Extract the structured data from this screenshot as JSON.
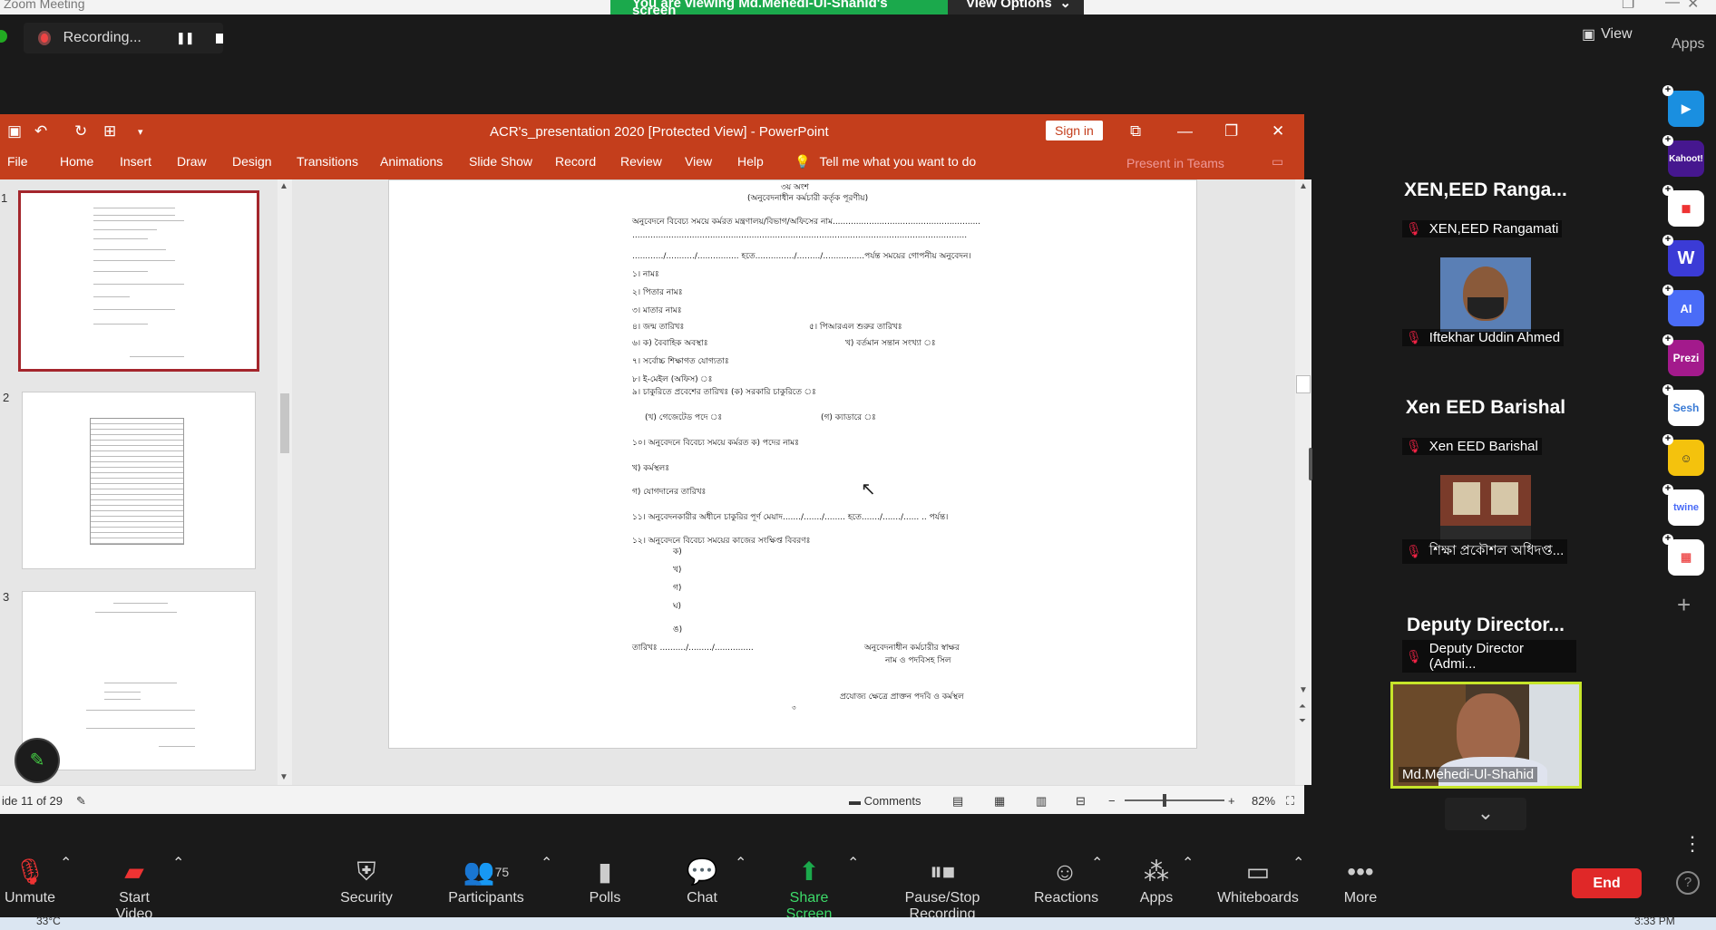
{
  "zoom": {
    "window_title": "Zoom Meeting",
    "banner_text": "You are viewing Md.Mehedi-Ul-Shahid's screen",
    "view_options_label": "View Options",
    "recording_label": "Recording...",
    "view_label": "View",
    "apps_label": "Apps"
  },
  "powerpoint": {
    "title": "ACR's_presentation 2020 [Protected View]  -  PowerPoint",
    "sign_in": "Sign in",
    "tabs": [
      "File",
      "Home",
      "Insert",
      "Draw",
      "Design",
      "Transitions",
      "Animations",
      "Slide Show",
      "Record",
      "Review",
      "View",
      "Help"
    ],
    "tell_me": "Tell me what you want to do",
    "present_in_teams": "Present in Teams",
    "thumb_numbers": [
      "1",
      "2",
      "3"
    ],
    "status": {
      "slide_count": "ide 11 of 29",
      "comments": "Comments",
      "zoom": "82%"
    },
    "slide_text": [
      "৩য় অংশ",
      "(অনুবেদনাধীন কর্মচারী কর্তৃক পূরণীয়)",
      "অনুবেদনে বিবেচ্য সময়ে কর্মরত মন্ত্রণালয়/বিভাগ/অফিসের নাম.........................................................",
      ".................................................................................................................................",
      "............/.........../................ হতে.............../........./................পর্যন্ত সময়ের গোপনীয় অনুবেদন।",
      "১। নামঃ",
      "২। পিতার নামঃ",
      "৩। মাতার নামঃ",
      "৪। জন্ম তারিখঃ",
      "৫। পিআরএল শুরুর তারিখঃ",
      "৬। ক) বৈবাহিক অবস্থাঃ",
      "খ) বর্তমান সন্তান সংখ্যা ঃ",
      "৭। সর্বোচ্চ শিক্ষাগত যোগ্যতাঃ",
      "৮। ই-মেইল (অফিস) ঃ",
      "৯। চাকুরিতে প্রবেশের তারিখঃ (ক) সরকারি চাকুরিতে ঃ",
      "(খ) গেজেটেড পদে ঃ",
      "(গ) ক্যাডারে ঃ",
      "১০। অনুবেদনে বিবেচ্য সময়ে কর্মরত ক) পদের নামঃ",
      "খ) কর্মস্থলঃ",
      "গ) যোগদানের তারিখঃ",
      "১১। অনুবেদনকারীর অধীনে চাকুরির পূর্ণ মেয়াদ......./......./........ হতে......./......./...... .. পর্যন্ত।",
      "১২। অনুবেদনে বিবেচ্য সময়ের কাজের সংক্ষিপ্ত বিবরণঃ",
      "ক)",
      "খ)",
      "গ)",
      "ঘ)",
      "ঙ)",
      "তারিখঃ  ........../........./...............",
      "অনুবেদনাধীন কর্মচারীর স্বাক্ষর",
      "নাম ও পদবিসহ সিল",
      "প্রযোজ্য ক্ষেত্রে প্রাক্তন পদবি ও কর্মস্থল",
      "৩"
    ]
  },
  "participants_panel": [
    {
      "big": "XEN,EED  Ranga...",
      "name": "XEN,EED Rangamati"
    },
    {
      "big": "",
      "name": "Iftekhar Uddin Ahmed"
    },
    {
      "big": "Xen EED Barishal",
      "name": "Xen EED Barishal"
    },
    {
      "big": "",
      "name": "শিক্ষা প্রকৌশল অধিদপ্ত..."
    },
    {
      "big": "Deputy  Director...",
      "name": "Deputy Director (Admi..."
    }
  ],
  "active_speaker": "Md.Mehedi-Ul-Shahid",
  "side_apps": [
    {
      "name": "kahoot-like",
      "label": "Kahoot!",
      "color": "#46178f"
    },
    {
      "name": "w-app",
      "label": "W",
      "color": "#3b3bd6"
    },
    {
      "name": "ai-app",
      "label": "AI",
      "color": "#4a6cf7"
    },
    {
      "name": "prezi",
      "label": "Prezi",
      "color": "#a31a8c"
    },
    {
      "name": "sesh",
      "label": "Sesh",
      "color": "#ffffff"
    },
    {
      "name": "emoji-app",
      "label": "",
      "color": "#f4c20d"
    },
    {
      "name": "twine",
      "label": "twine",
      "color": "#ffffff"
    },
    {
      "name": "grid-app",
      "label": "",
      "color": "#ffffff"
    }
  ],
  "toolbar": {
    "unmute": "Unmute",
    "start_video": "Start Video",
    "security": "Security",
    "participants": "Participants",
    "participants_count": "75",
    "polls": "Polls",
    "chat": "Chat",
    "share_screen": "Share Screen",
    "pause_stop_recording": "Pause/Stop Recording",
    "reactions": "Reactions",
    "apps": "Apps",
    "whiteboards": "Whiteboards",
    "more": "More",
    "end": "End"
  },
  "taskbar": {
    "weather": "33°C",
    "clock": "3:33 PM"
  },
  "colors": {
    "ppt_accent": "#c43e1c",
    "share_green": "#1ba94c",
    "end_red": "#e02828",
    "active_border": "#c6e52a"
  }
}
